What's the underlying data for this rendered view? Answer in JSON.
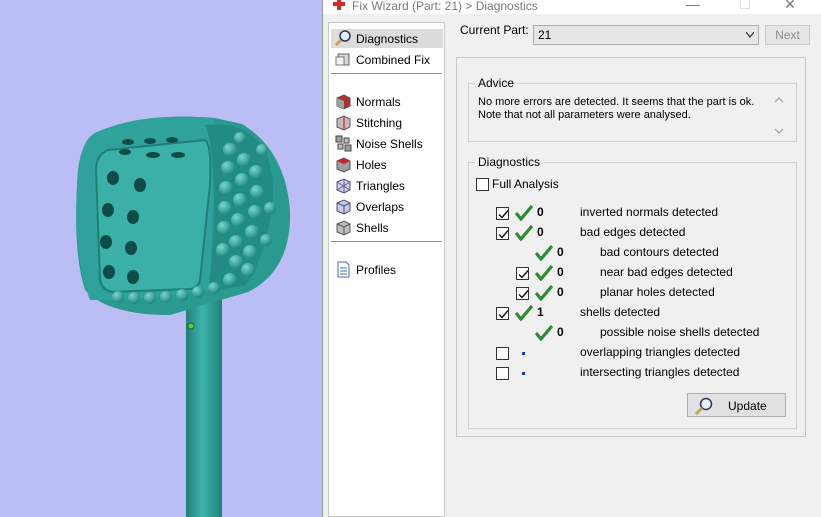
{
  "window": {
    "title": "Fix Wizard (Part: 21) > Diagnostics",
    "min_glyph": "—",
    "max_glyph": "☐",
    "close_glyph": "✕"
  },
  "nav": {
    "items": [
      {
        "label": "Diagnostics",
        "icon": "magnifier-icon",
        "selected": true
      },
      {
        "label": "Combined Fix",
        "icon": "combined-fix-icon"
      },
      {
        "label": "Normals",
        "icon": "normals-cube-icon"
      },
      {
        "label": "Stitching",
        "icon": "stitching-icon"
      },
      {
        "label": "Noise Shells",
        "icon": "noise-shells-icon"
      },
      {
        "label": "Holes",
        "icon": "holes-icon"
      },
      {
        "label": "Triangles",
        "icon": "triangles-icon"
      },
      {
        "label": "Overlaps",
        "icon": "overlaps-icon"
      },
      {
        "label": "Shells",
        "icon": "shells-icon"
      },
      {
        "label": "Profiles",
        "icon": "profiles-document-icon"
      }
    ]
  },
  "current_part": {
    "label": "Current Part:",
    "value": "21",
    "next_label": "Next"
  },
  "advice": {
    "title": "Advice",
    "line1": "No more errors are detected. It seems that the part is ok.",
    "line2": "Note that not all parameters were analysed."
  },
  "diagnostics": {
    "title": "Diagnostics",
    "full_analysis_label": "Full Analysis",
    "full_analysis_checked": false,
    "rows": [
      {
        "checked": true,
        "status": "ok",
        "count": "0",
        "label": "inverted normals detected"
      },
      {
        "checked": true,
        "status": "ok",
        "count": "0",
        "label": "bad edges detected"
      },
      {
        "checked": null,
        "status": "ok",
        "count": "0",
        "label": "bad contours detected"
      },
      {
        "checked": true,
        "status": "ok",
        "count": "0",
        "label": "near bad edges detected"
      },
      {
        "checked": true,
        "status": "ok",
        "count": "0",
        "label": "planar holes detected"
      },
      {
        "checked": true,
        "status": "ok",
        "count": "1",
        "label": "shells detected"
      },
      {
        "checked": null,
        "status": "ok",
        "count": "0",
        "label": "possible noise shells detected"
      },
      {
        "checked": false,
        "status": "pending",
        "count": "",
        "label": "overlapping triangles detected"
      },
      {
        "checked": false,
        "status": "pending",
        "count": "",
        "label": "intersecting triangles detected"
      }
    ],
    "update_label": "Update"
  },
  "colors": {
    "viewport_bg": "#bbbdf5",
    "model": "#2fa39b",
    "ok_tick": "#2f8a2f",
    "pending_dot": "#1a3bbd"
  }
}
